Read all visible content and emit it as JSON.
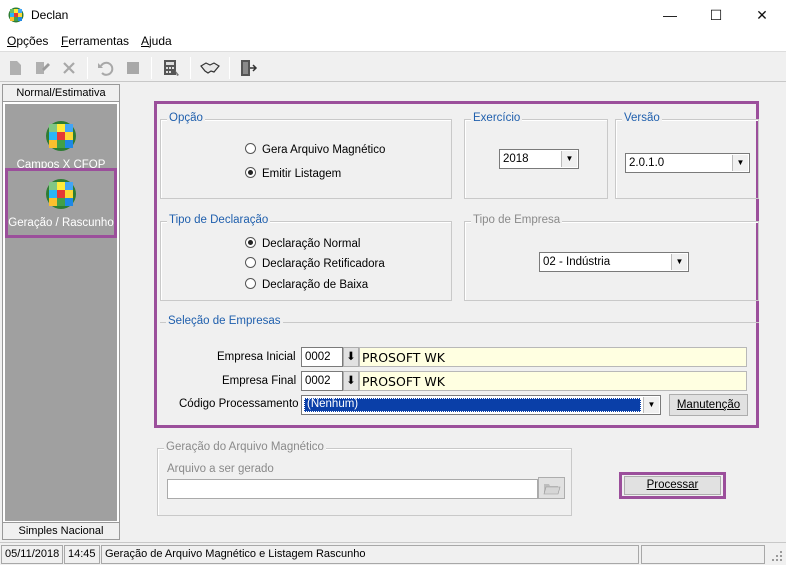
{
  "window": {
    "title": "Declan",
    "minimize": "—",
    "maximize": "☐",
    "close": "✕"
  },
  "menu": {
    "opcoes": {
      "first": "O",
      "rest": "pções"
    },
    "ferramentas": {
      "first": "F",
      "rest": "erramentas"
    },
    "ajuda": {
      "first": "A",
      "rest": "juda"
    }
  },
  "toolbar": [
    "new-document-icon",
    "edit-icon",
    "delete-icon",
    "undo-icon",
    "stop-icon",
    "calculator-icon",
    "handshake-icon",
    "exit-door-icon"
  ],
  "sidebar": {
    "header": "Normal/Estimativa",
    "items": [
      {
        "label": "Campos X CFOP",
        "icon": "colorful-grid-icon"
      },
      {
        "label": "Geração / Rascunho",
        "icon": "colorful-grid-icon"
      }
    ],
    "footer": "Simples Nacional"
  },
  "opcao": {
    "title": "Opção",
    "options": [
      {
        "label": "Gera Arquivo Magnético",
        "selected": false
      },
      {
        "label": "Emitir Listagem",
        "selected": true
      }
    ]
  },
  "exercicio": {
    "title": "Exercício",
    "value": "2018"
  },
  "versao": {
    "title": "Versão",
    "value": "2.0.1.0"
  },
  "tipo_declaracao": {
    "title": "Tipo de Declaração",
    "options": [
      {
        "label": "Declaração Normal",
        "selected": true
      },
      {
        "label": "Declaração Retificadora",
        "selected": false
      },
      {
        "label": "Declaração de Baixa",
        "selected": false
      }
    ]
  },
  "tipo_empresa": {
    "title": "Tipo de Empresa",
    "value": "02 - Indústria"
  },
  "selecao": {
    "title": "Seleção de Empresas",
    "empresa_inicial": {
      "label": "Empresa Inicial",
      "code": "0002",
      "name": "PROSOFT WK"
    },
    "empresa_final": {
      "label": "Empresa Final",
      "code": "0002",
      "name": "PROSOFT WK"
    },
    "codigo": {
      "label": "Código Processamento",
      "value": "(Nenhum)"
    },
    "manutencao_label": "Manutenção"
  },
  "arquivo": {
    "title": "Geração do Arquivo Magnético",
    "label": "Arquivo a ser gerado",
    "value": ""
  },
  "processar_label": "Processar",
  "status": {
    "date": "05/11/2018",
    "time": "14:45",
    "message": "Geração de Arquivo Magnético e Listagem Rascunho"
  },
  "colors": {
    "highlight": "#9b4f9b",
    "group_title": "#1f5fad",
    "selection": "#0a3fa8"
  }
}
